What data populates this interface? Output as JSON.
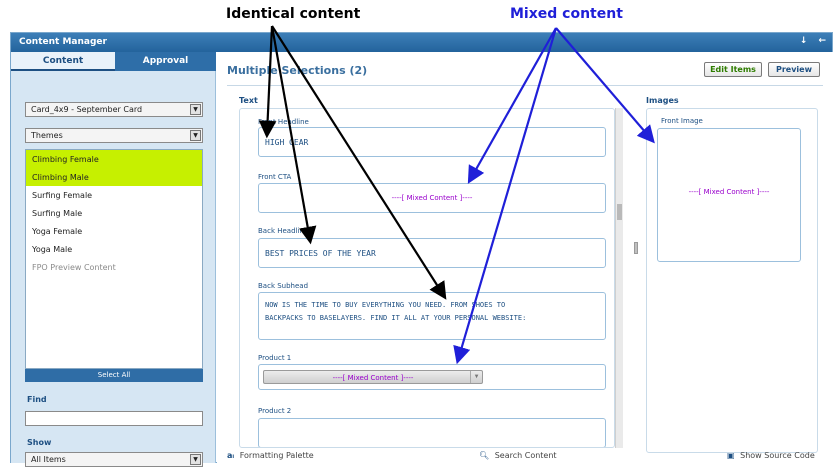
{
  "callouts": {
    "identical": "Identical content",
    "mixed": "Mixed content"
  },
  "window": {
    "title": "Content Manager",
    "title_icons": [
      "pin-icon",
      "collapse-icon"
    ]
  },
  "left_panel": {
    "tabs": [
      {
        "label": "Content",
        "active": true
      },
      {
        "label": "Approval",
        "active": false
      }
    ],
    "card_select": {
      "value": "Card_4x9 - September Card"
    },
    "themes_select": {
      "value": "Themes"
    },
    "theme_list": [
      {
        "label": "Climbing Female",
        "selected": true
      },
      {
        "label": "Climbing Male",
        "selected": true
      },
      {
        "label": "Surfing Female",
        "selected": false
      },
      {
        "label": "Surfing Male",
        "selected": false
      },
      {
        "label": "Yoga Female",
        "selected": false
      },
      {
        "label": "Yoga Male",
        "selected": false
      },
      {
        "label": "FPO Preview Content",
        "selected": false
      }
    ],
    "select_all": "Select All",
    "find_label": "Find",
    "find_value": "",
    "show_label": "Show",
    "show_select": {
      "value": "All Items"
    }
  },
  "main": {
    "title": "Multiple Selections (2)",
    "buttons": {
      "edit_items": "Edit Items",
      "preview": "Preview"
    },
    "text_section": {
      "label": "Text",
      "fields": [
        {
          "label": "Front Headline",
          "value": "HIGH GEAR"
        },
        {
          "label": "Front CTA",
          "value": "----[ Mixed Content ]----"
        },
        {
          "label": "Back Headline",
          "value": "BEST PRICES OF THE YEAR"
        },
        {
          "label": "Back Subhead",
          "value_line1": "NOW IS THE TIME TO BUY EVERYTHING YOU NEED. FROM SHOES TO",
          "value_line2": "BACKPACKS TO BASELAYERS. FIND IT ALL AT YOUR PERSONAL WEBSITE:"
        },
        {
          "label": "Product 1",
          "value": "----[ Mixed Content ]----"
        },
        {
          "label": "Product 2",
          "value": ""
        }
      ]
    },
    "images_section": {
      "label": "Images",
      "front_image_label": "Front Image",
      "front_image_value": "----[ Mixed Content ]----"
    }
  },
  "bottom_bar": {
    "formatting_palette": "Formatting Palette",
    "search_content": "Search Content",
    "show_source_code": "Show Source Code"
  },
  "colors": {
    "titlebar": "#2b6fa9",
    "selected_theme": "#c6f000",
    "mixed_text": "#9900cc",
    "mixed_callout": "#1f1fd8",
    "identical_callout": "#000000"
  }
}
